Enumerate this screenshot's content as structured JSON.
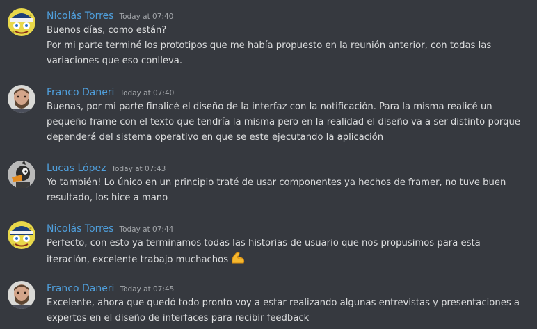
{
  "messages": [
    {
      "author": "Nicolás Torres",
      "time": "Today at 07:40",
      "avatar": "sponge-character-avatar",
      "lines": [
        "Buenos días, como están?",
        "Por mi parte terminé los prototipos que me había propuesto en la reunión anterior, con todas las",
        "variaciones que eso conlleva."
      ]
    },
    {
      "author": "Franco Daneri",
      "time": "Today at 07:40",
      "avatar": "bearded-man-avatar",
      "lines": [
        "Buenas, por mi parte finalicé el diseño de la interfaz con la notificación. Para la misma realicé un",
        "pequeño frame con el texto que tendría la misma pero en la realidad el diseño va a ser distinto porque",
        "dependerá del sistema operativo en que se este ejecutando la aplicación"
      ]
    },
    {
      "author": "Lucas López",
      "time": "Today at 07:43",
      "avatar": "duck-avatar",
      "lines": [
        "Yo también! Lo único en un principio traté de usar componentes ya hechos de framer, no tuve buen",
        "resultado, los hice a mano"
      ]
    },
    {
      "author": "Nicolás Torres",
      "time": "Today at 07:44",
      "avatar": "sponge-character-avatar",
      "lines": [
        "Perfecto, con esto ya terminamos todas las historias de usuario que nos propusimos para esta",
        "iteración, excelente trabajo muchachos"
      ],
      "emoji": "flexed-biceps-emoji"
    },
    {
      "author": "Franco Daneri",
      "time": "Today at 07:45",
      "avatar": "bearded-man-avatar",
      "lines": [
        "Excelente, ahora que quedó todo pronto voy a estar realizando algunas entrevistas y presentaciones a",
        "expertos en el diseño de interfaces para recibir feedback"
      ]
    }
  ],
  "colors": {
    "background": "#36393f",
    "author": "#4f9fdc",
    "timestamp": "#a3a6aa",
    "text": "#dcddde"
  }
}
